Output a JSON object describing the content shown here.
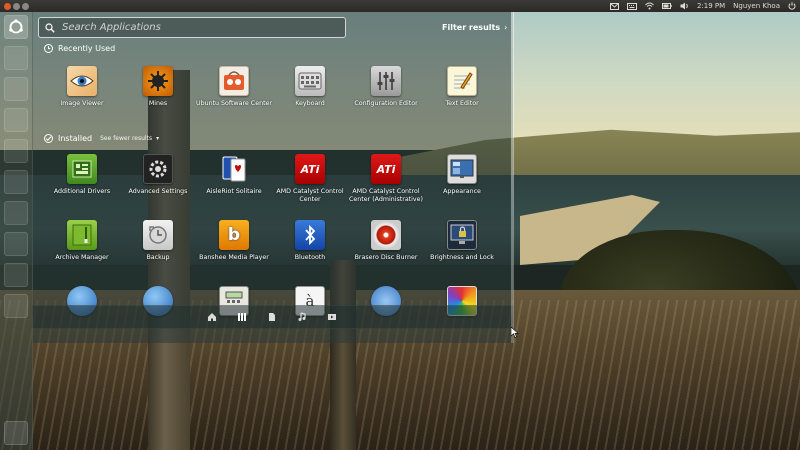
{
  "top_panel": {
    "time": "2:19 PM",
    "user": "Nguyen Khoa",
    "indicators": [
      "mail-icon",
      "keyboard-icon",
      "network-icon",
      "battery-icon",
      "volume-icon",
      "power-icon"
    ]
  },
  "launcher": {
    "items": [
      "ubuntu-home-icon",
      "app-icon",
      "app-icon",
      "app-icon",
      "app-icon",
      "app-icon",
      "app-icon",
      "app-icon",
      "app-icon"
    ],
    "trash": "trash-icon"
  },
  "dash": {
    "search": {
      "placeholder": "Search Applications"
    },
    "filter_label": "Filter results",
    "filter_chevron": "›",
    "recently_used": {
      "title": "Recently Used",
      "apps": [
        {
          "label": "Image Viewer",
          "icon": "image-viewer-icon"
        },
        {
          "label": "Mines",
          "icon": "mines-icon"
        },
        {
          "label": "Ubuntu Software Center",
          "icon": "software-center-icon"
        },
        {
          "label": "Keyboard",
          "icon": "keyboard-icon"
        },
        {
          "label": "Configuration Editor",
          "icon": "configuration-editor-icon"
        },
        {
          "label": "Text Editor",
          "icon": "text-editor-icon"
        }
      ]
    },
    "installed": {
      "title": "Installed",
      "toggle_label": "See fewer results",
      "toggle_chevron": "▾",
      "rows": [
        [
          {
            "label": "Additional Drivers",
            "icon": "additional-drivers-icon"
          },
          {
            "label": "Advanced Settings",
            "icon": "advanced-settings-icon"
          },
          {
            "label": "AisleRiot Solitaire",
            "icon": "solitaire-icon"
          },
          {
            "label": "AMD Catalyst Control Center",
            "icon": "ati-icon",
            "text": "ATi"
          },
          {
            "label": "AMD Catalyst Control Center (Administrative)",
            "icon": "ati-admin-icon",
            "text": "ATi"
          },
          {
            "label": "Appearance",
            "icon": "appearance-icon"
          }
        ],
        [
          {
            "label": "Archive Manager",
            "icon": "archive-manager-icon"
          },
          {
            "label": "Backup",
            "icon": "backup-icon"
          },
          {
            "label": "Banshee Media Player",
            "icon": "banshee-icon",
            "text": "b"
          },
          {
            "label": "Bluetooth",
            "icon": "bluetooth-icon"
          },
          {
            "label": "Brasero Disc Burner",
            "icon": "brasero-icon"
          },
          {
            "label": "Brightness and Lock",
            "icon": "brightness-lock-icon"
          }
        ],
        [
          {
            "label": "",
            "icon": "globe-icon"
          },
          {
            "label": "",
            "icon": "globe-icon"
          },
          {
            "label": "",
            "icon": "calculator-icon"
          },
          {
            "label": "",
            "icon": "character-map-icon",
            "text": "à"
          },
          {
            "label": "",
            "icon": "cheese-icon"
          },
          {
            "label": "",
            "icon": "color-icon"
          }
        ]
      ]
    },
    "lenses": [
      "home-lens-icon",
      "applications-lens-icon",
      "files-lens-icon",
      "music-lens-icon",
      "video-lens-icon"
    ],
    "active_lens": "applications-lens-icon"
  },
  "colors": {
    "dash_tint": "#283a3a",
    "ati_red": "#d01010",
    "ubuntu_orange": "#e05a2b"
  }
}
